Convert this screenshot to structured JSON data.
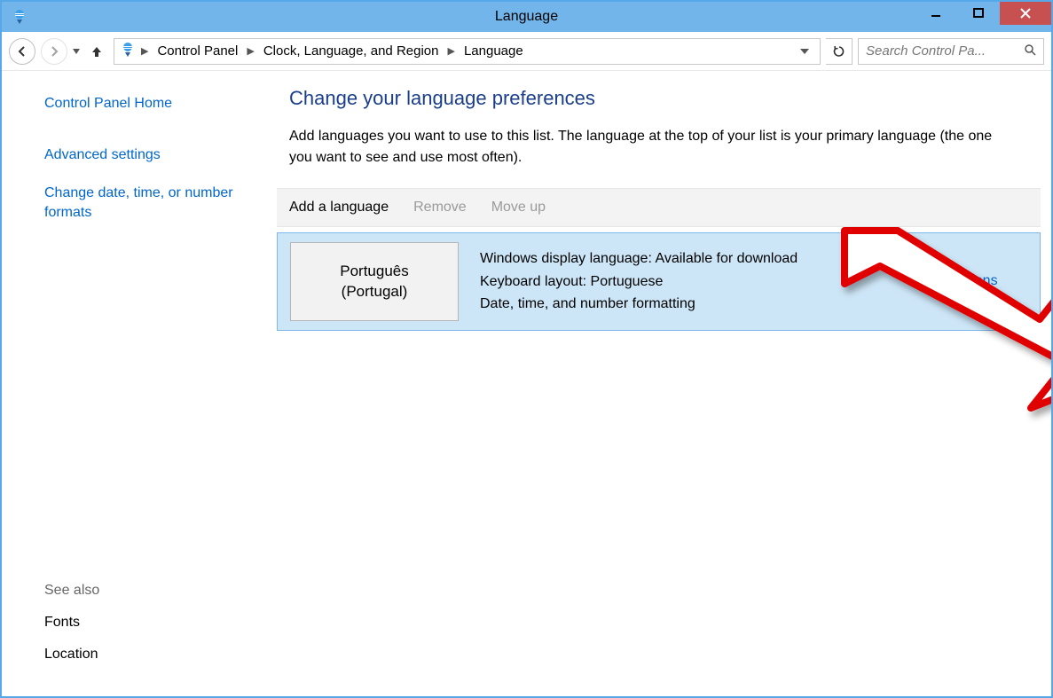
{
  "window": {
    "title": "Language"
  },
  "breadcrumb": {
    "items": [
      "Control Panel",
      "Clock, Language, and Region",
      "Language"
    ]
  },
  "search": {
    "placeholder": "Search Control Pa..."
  },
  "sidebar": {
    "home": "Control Panel Home",
    "links": [
      "Advanced settings",
      "Change date, time, or number formats"
    ],
    "see_also_label": "See also",
    "see_also": [
      "Fonts",
      "Location"
    ]
  },
  "main": {
    "heading": "Change your language preferences",
    "description": "Add languages you want to use to this list. The language at the top of your list is your primary language (the one you want to see and use most often).",
    "toolbar": {
      "add": "Add a language",
      "remove": "Remove",
      "move_up": "Move up"
    },
    "language_row": {
      "tile_line1": "Português",
      "tile_line2": "(Portugal)",
      "info_line1": "Windows display language: Available for download",
      "info_line2": "Keyboard layout: Portuguese",
      "info_line3": "Date, time, and number formatting",
      "options": "Options"
    }
  }
}
